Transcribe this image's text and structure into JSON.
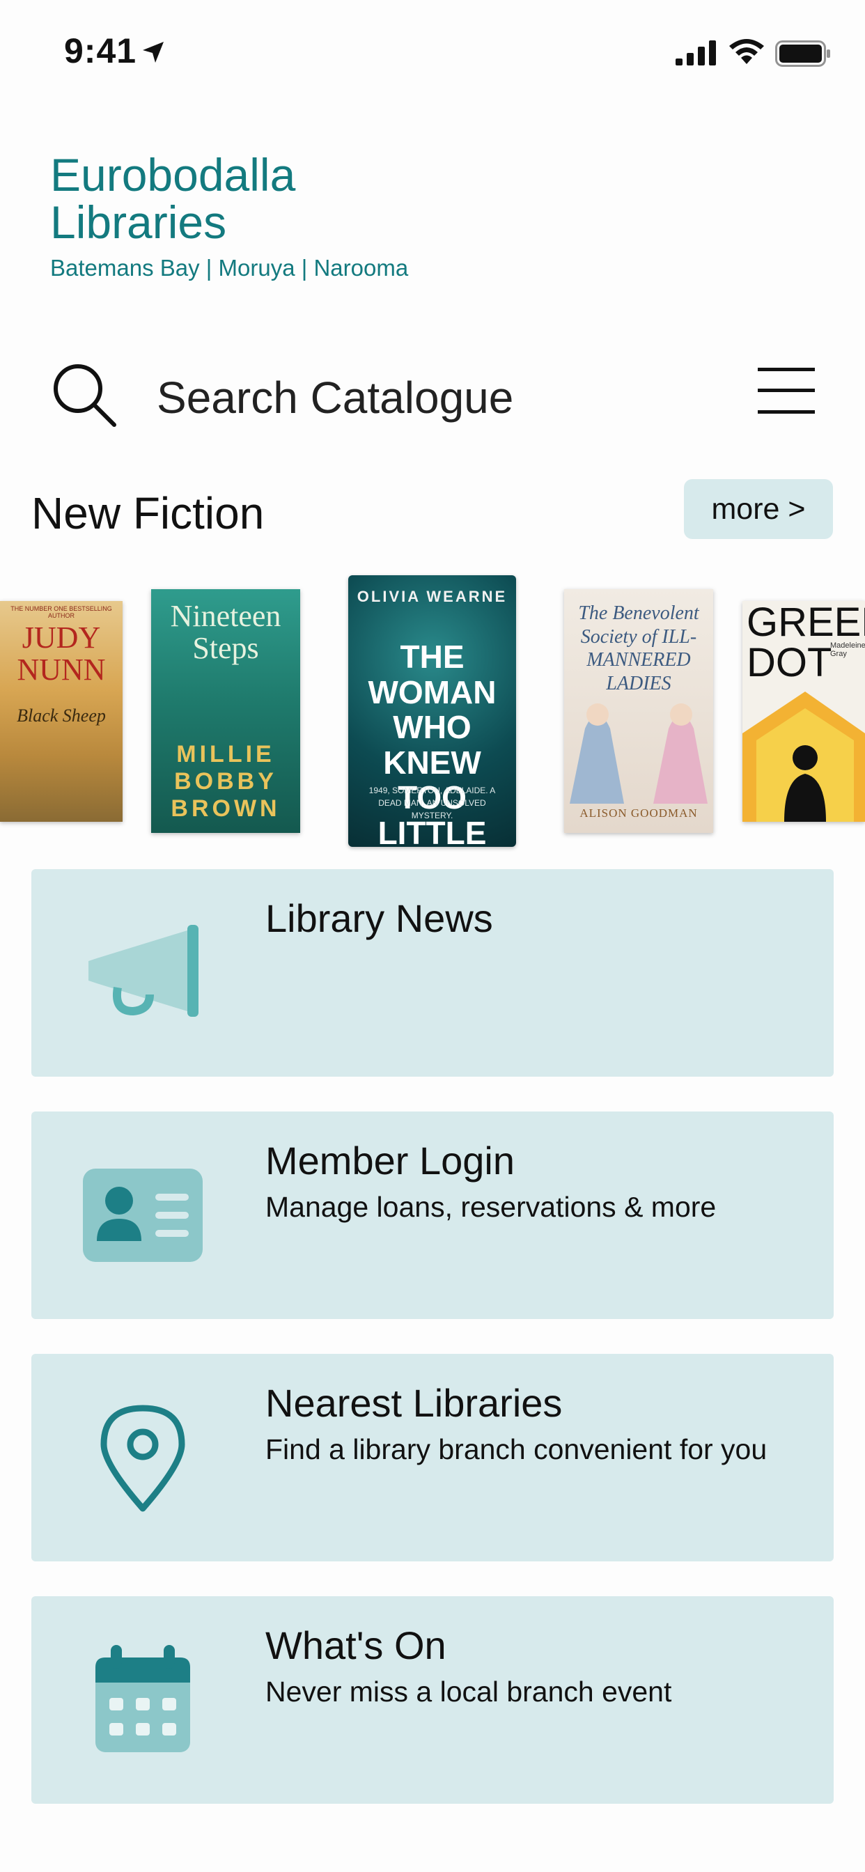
{
  "status_bar": {
    "time": "9:41"
  },
  "brand": {
    "line1": "Eurobodalla",
    "line2": "Libraries",
    "subtitle": "Batemans Bay | Moruya | Narooma"
  },
  "search": {
    "label": "Search Catalogue"
  },
  "section": {
    "title": "New Fiction",
    "more_label": "more >"
  },
  "books": [
    {
      "author": "JUDY NUNN",
      "title": "Black Sheep",
      "banner": "THE NUMBER ONE BESTSELLING AUTHOR"
    },
    {
      "author": "MILLIE BOBBY BROWN",
      "title": "Nineteen Steps"
    },
    {
      "author": "OLIVIA WEARNE",
      "title": "THE WOMAN WHO KNEW TOO LITTLE",
      "tagline": "1949, SOMERTON, ADELAIDE. A DEAD MAN. AN UNSOLVED MYSTERY."
    },
    {
      "author": "ALISON GOODMAN",
      "title": "The Benevolent Society of ILL-MANNERED LADIES"
    },
    {
      "author": "Madeleine Gray",
      "title": "GREEN DOT"
    }
  ],
  "cards": [
    {
      "title": "Library News",
      "subtitle": "",
      "icon": "megaphone-icon"
    },
    {
      "title": "Member Login",
      "subtitle": "Manage loans, reservations & more",
      "icon": "id-card-icon"
    },
    {
      "title": "Nearest Libraries",
      "subtitle": "Find a library branch convenient for you",
      "icon": "map-pin-icon"
    },
    {
      "title": "What's On",
      "subtitle": "Never miss a local branch event",
      "icon": "calendar-icon"
    }
  ],
  "colors": {
    "brand": "#137a7f",
    "card_bg": "#d7eaec",
    "icon_teal": "#8cc7c9",
    "icon_dark": "#1d7f86"
  }
}
